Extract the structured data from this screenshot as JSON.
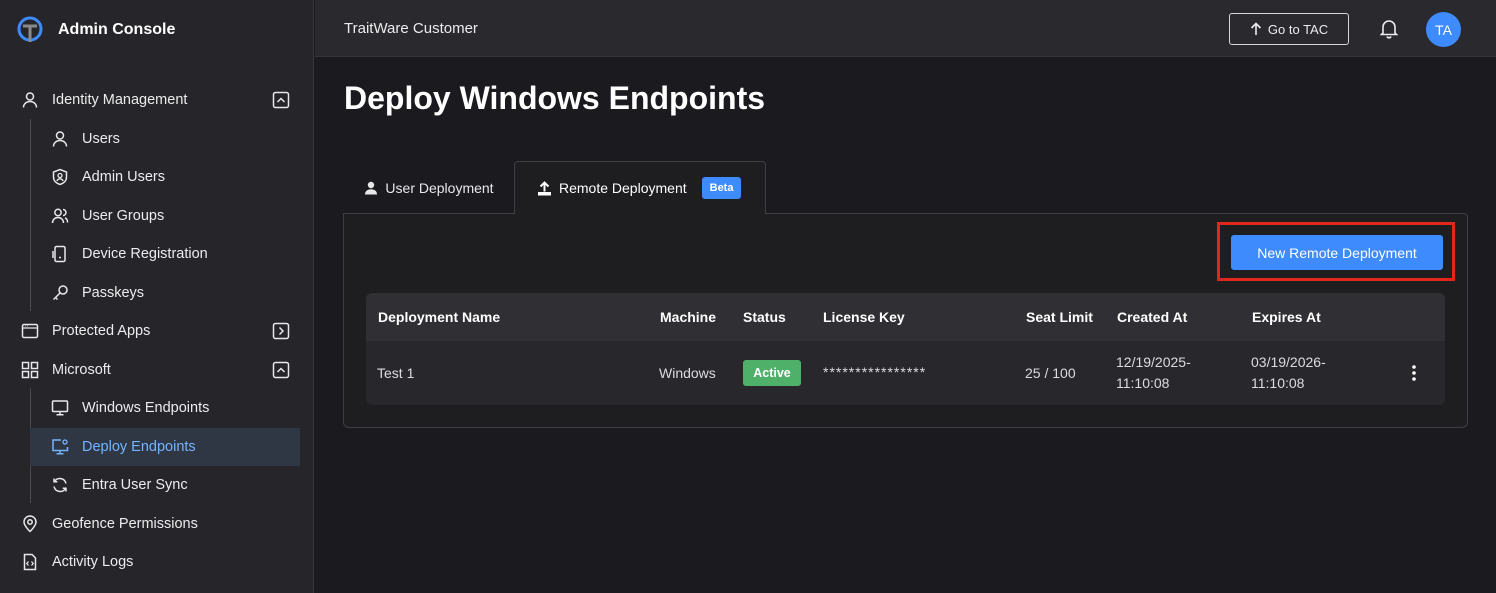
{
  "sidebar": {
    "brand": "Admin Console",
    "items": [
      {
        "label": "Identity Management",
        "icon": "user-icon"
      },
      {
        "label": "Users",
        "icon": "user-icon"
      },
      {
        "label": "Admin Users",
        "icon": "shield-user-icon"
      },
      {
        "label": "User Groups",
        "icon": "users-icon"
      },
      {
        "label": "Device Registration",
        "icon": "device-icon"
      },
      {
        "label": "Passkeys",
        "icon": "key-icon"
      },
      {
        "label": "Protected Apps",
        "icon": "browser-window-icon"
      },
      {
        "label": "Microsoft",
        "icon": "grid-icon"
      },
      {
        "label": "Windows Endpoints",
        "icon": "monitor-icon"
      },
      {
        "label": "Deploy Endpoints",
        "icon": "monitor-gear-icon"
      },
      {
        "label": "Entra User Sync",
        "icon": "sync-icon"
      },
      {
        "label": "Geofence Permissions",
        "icon": "location-pin-icon"
      },
      {
        "label": "Activity Logs",
        "icon": "file-code-icon"
      }
    ]
  },
  "header": {
    "tenant": "TraitWare Customer",
    "go_to_tac": "Go to TAC",
    "avatar_initials": "TA"
  },
  "main": {
    "title": "Deploy Windows Endpoints",
    "tabs": [
      {
        "label": "User Deployment"
      },
      {
        "label": "Remote Deployment",
        "badge": "Beta"
      }
    ],
    "new_button": "New Remote Deployment",
    "table": {
      "columns": [
        "Deployment Name",
        "Machine",
        "Status",
        "License Key",
        "Seat Limit",
        "Created At",
        "Expires At"
      ],
      "rows": [
        {
          "name": "Test 1",
          "machine": "Windows",
          "status": "Active",
          "license_key": "****************",
          "seat_limit": "25 / 100",
          "created_date": "12/19/2025-",
          "created_time": "11:10:08",
          "expires_date": "03/19/2026-",
          "expires_time": "11:10:08"
        }
      ]
    }
  },
  "colors": {
    "accent": "#3d8bfd",
    "active_nav_text": "#74b4ff",
    "status_active": "#4fb06a",
    "highlight_box": "#e1261c"
  }
}
